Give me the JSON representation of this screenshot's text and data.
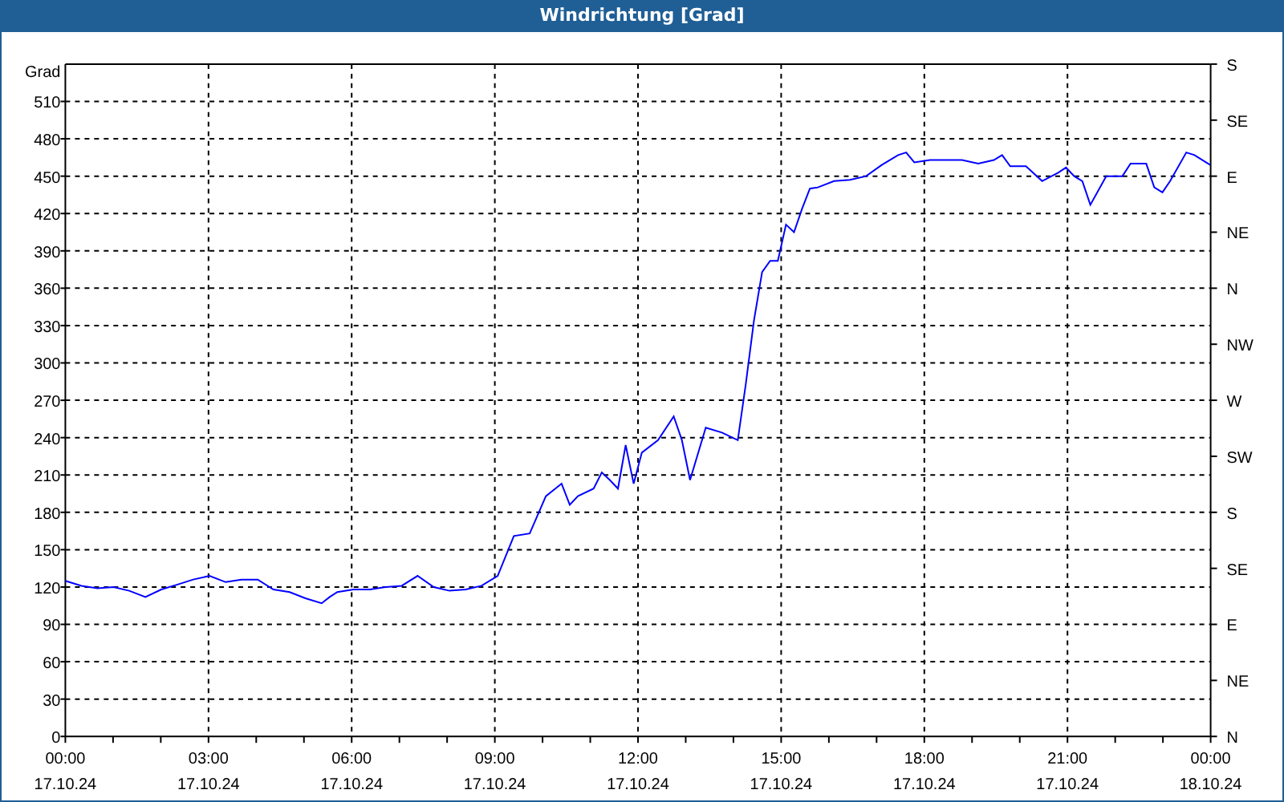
{
  "window": {
    "title": "Windrichtung [Grad]"
  },
  "chart": {
    "chart_data": {
      "type": "line",
      "grid": true,
      "ylabel": "Grad",
      "xlim": [
        0,
        24
      ],
      "ylim": [
        0,
        540
      ],
      "x": [
        0,
        0.34,
        0.67,
        1.01,
        1.34,
        1.68,
        2.01,
        2.35,
        2.68,
        3.02,
        3.36,
        3.69,
        4.03,
        4.36,
        4.7,
        5.03,
        5.37,
        5.54,
        5.7,
        6.04,
        6.38,
        6.71,
        7.05,
        7.38,
        7.72,
        8.05,
        8.39,
        8.72,
        9.06,
        9.4,
        9.73,
        10.07,
        10.4,
        10.57,
        10.74,
        11.07,
        11.24,
        11.41,
        11.58,
        11.74,
        11.91,
        12.08,
        12.42,
        12.75,
        12.92,
        13.09,
        13.42,
        13.76,
        14.09,
        14.26,
        14.43,
        14.6,
        14.77,
        14.93,
        15.1,
        15.27,
        15.44,
        15.6,
        15.77,
        16.11,
        16.44,
        16.78,
        17.11,
        17.45,
        17.62,
        17.79,
        18.12,
        18.46,
        18.79,
        19.13,
        19.46,
        19.63,
        19.8,
        20.13,
        20.47,
        20.81,
        20.97,
        21.14,
        21.31,
        21.48,
        21.81,
        22.15,
        22.32,
        22.65,
        22.82,
        22.99,
        23.15,
        23.49,
        23.66,
        23.99
      ],
      "series": [
        {
          "color": "#0000ff",
          "values": [
            125,
            121,
            119,
            120,
            117,
            112,
            118,
            122,
            126,
            129,
            124,
            126,
            126,
            118,
            116,
            111,
            107,
            112,
            116,
            118,
            118,
            120,
            121,
            129,
            120,
            117,
            118,
            121,
            129,
            161,
            163,
            193,
            203,
            186,
            193,
            199,
            212,
            206,
            199,
            234,
            203,
            228,
            238,
            257,
            238,
            206,
            248,
            244,
            238,
            283,
            334,
            373,
            382,
            382,
            411,
            405,
            424,
            440,
            441,
            446,
            447,
            450,
            459,
            467,
            469,
            461,
            463,
            463,
            463,
            460,
            463,
            467,
            458,
            458,
            446,
            453,
            457,
            450,
            446,
            427,
            450,
            450,
            460,
            460,
            441,
            437,
            446,
            469,
            467,
            459
          ]
        }
      ],
      "yticks": [
        0,
        30,
        60,
        90,
        120,
        150,
        180,
        210,
        240,
        270,
        300,
        330,
        360,
        390,
        420,
        450,
        480,
        510
      ],
      "xticks": [
        {
          "value": 0,
          "label": "00:00"
        },
        {
          "value": 3,
          "label": "03:00"
        },
        {
          "value": 6,
          "label": "06:00"
        },
        {
          "value": 9,
          "label": "09:00"
        },
        {
          "value": 12,
          "label": "12:00"
        },
        {
          "value": 15,
          "label": "15:00"
        },
        {
          "value": 18,
          "label": "18:00"
        },
        {
          "value": 21,
          "label": "21:00"
        },
        {
          "value": 24,
          "label": "00:00"
        }
      ]
    },
    "x_dates": [
      "17.10.24",
      "17.10.24",
      "17.10.24",
      "17.10.24",
      "17.10.24",
      "17.10.24",
      "17.10.24",
      "17.10.24",
      "18.10.24"
    ],
    "compass_labels": [
      "S",
      "SE",
      "E",
      "NE",
      "N",
      "NW",
      "W",
      "SW",
      "S",
      "SE",
      "E",
      "NE",
      "N"
    ]
  }
}
